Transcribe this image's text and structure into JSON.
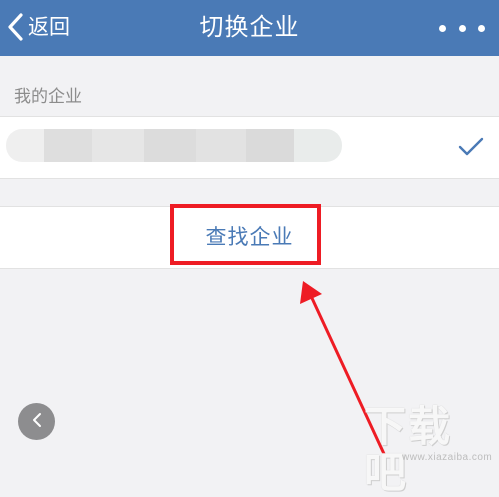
{
  "navbar": {
    "back_label": "返回",
    "title": "切换企业"
  },
  "companies": {
    "section_header": "我的企业",
    "selected": true
  },
  "actions": {
    "find_company_label": "查找企业"
  },
  "watermark": {
    "logo_text": "下载吧",
    "url": "www.xiazaiba.com"
  },
  "colors": {
    "navbar_bg": "#4a7ab6",
    "accent_text": "#4a7ab6",
    "highlight": "#ee1c24",
    "background": "#f2f2f4"
  },
  "icons": {
    "back": "chevron-left-icon",
    "more": "more-dots-icon",
    "selected": "checkmark-icon",
    "floating_back": "chevron-left-icon"
  }
}
